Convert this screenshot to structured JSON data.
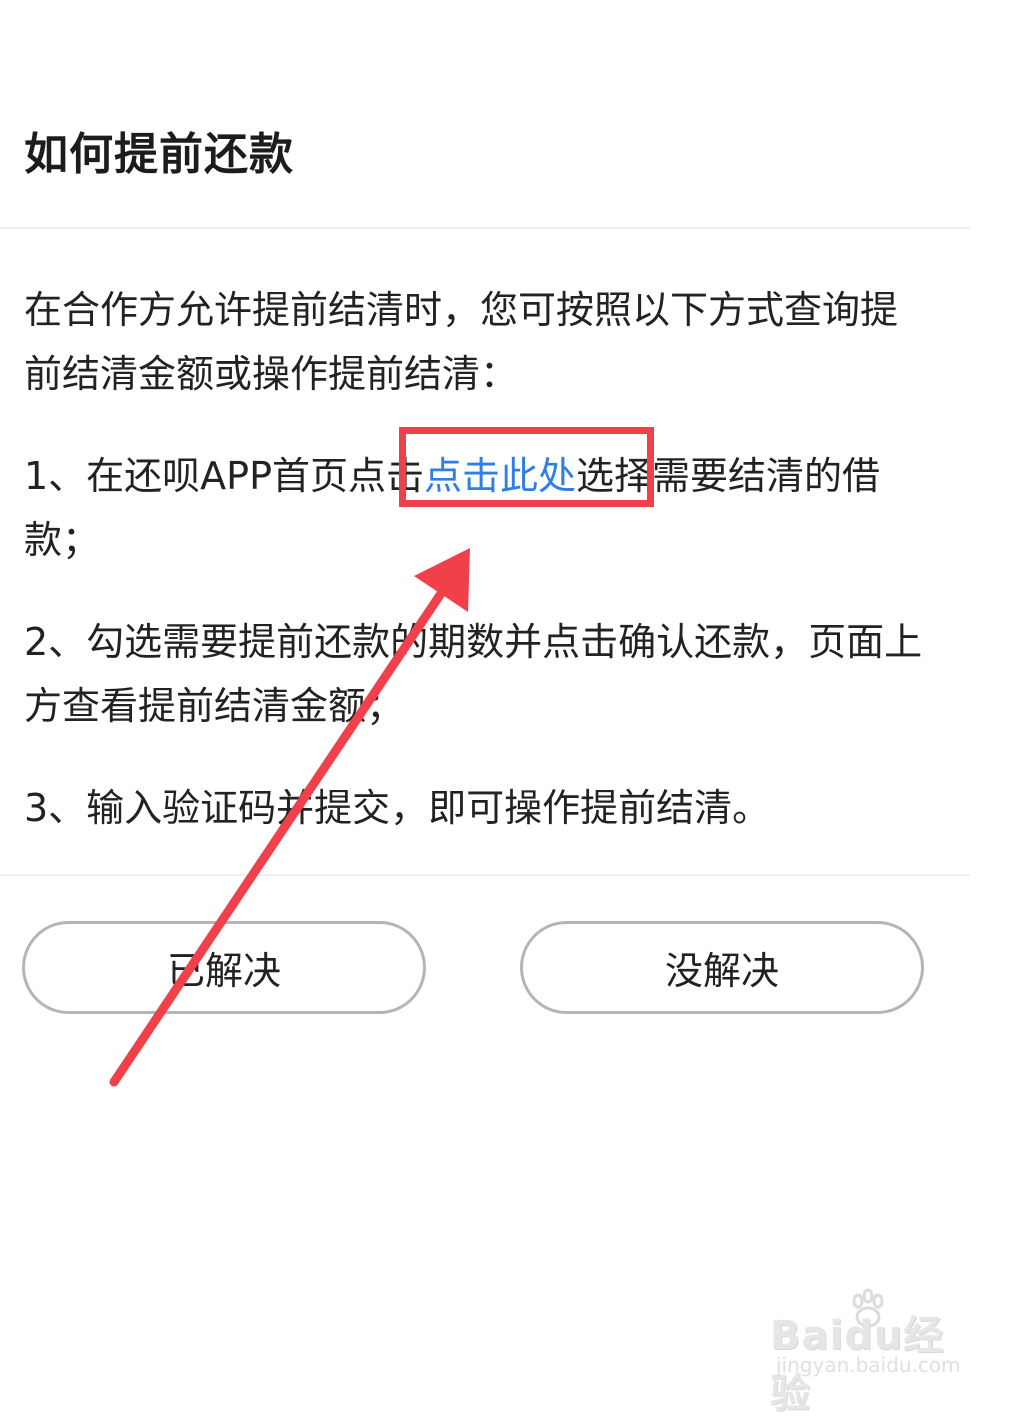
{
  "title": "如何提前还款",
  "content": {
    "intro": "在合作方允许提前结清时，您可按照以下方式查询提前结清金额或操作提前结清：",
    "step1": {
      "before": "1、在还呗APP首页点击",
      "link": "点击此处",
      "after": "选择需要结清的借款；"
    },
    "step2": "2、勾选需要提前还款的期数并点击确认还款，页面上方查看提前结清金额；",
    "step3": "3、输入验证码并提交，即可操作提前结清。"
  },
  "buttons": {
    "resolved": "已解决",
    "unresolved": "没解决"
  },
  "watermark": {
    "logo": "Baidu经验",
    "url": "jingyan.baidu.com"
  },
  "colors": {
    "link": "#2f7ee6",
    "annotation": "#f0414a"
  },
  "icons": [
    "arrow-annotation-icon",
    "baidu-paw-icon"
  ]
}
